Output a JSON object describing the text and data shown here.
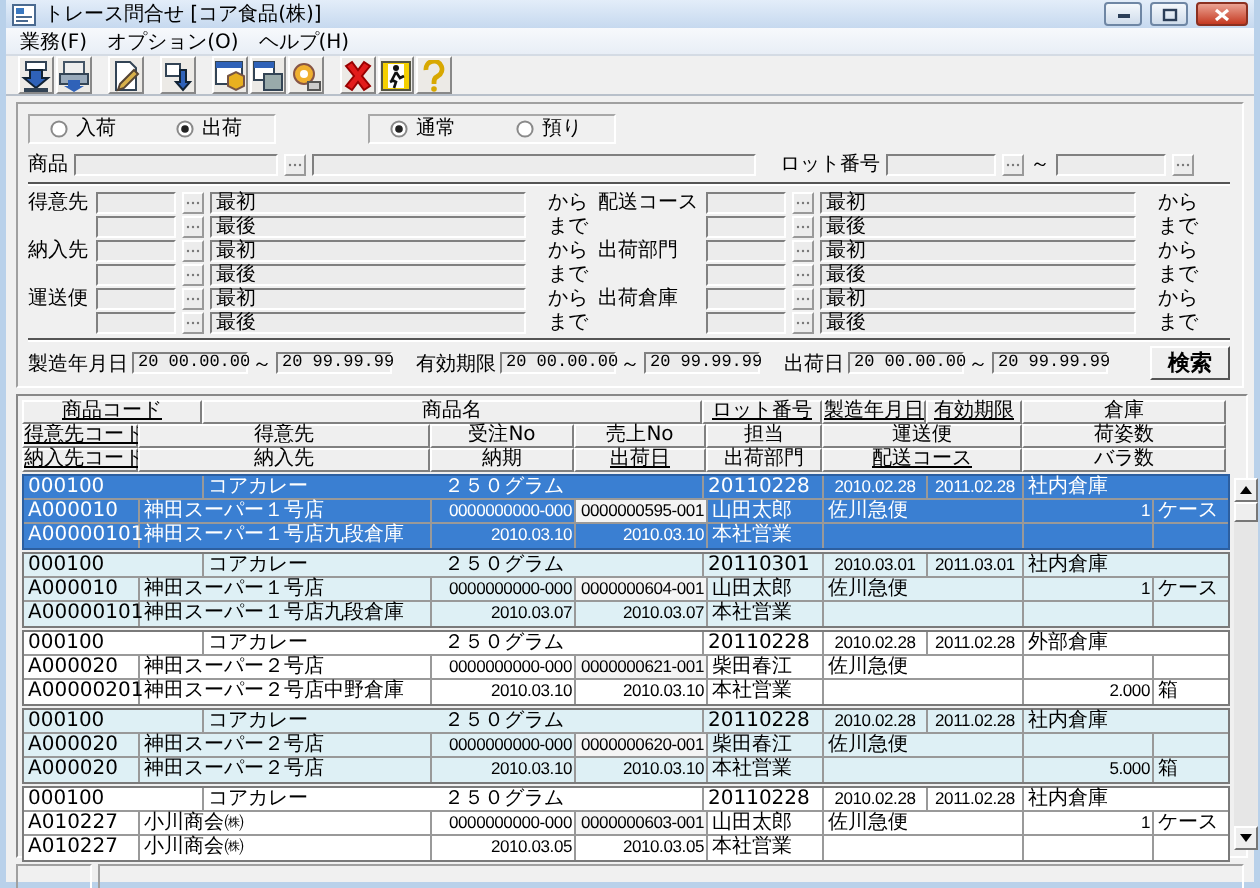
{
  "window": {
    "title": "トレース問合せ [コア食品(株)]"
  },
  "menu": [
    "業務(F)",
    "オプション(O)",
    "ヘルプ(H)"
  ],
  "filters": {
    "direction": [
      {
        "label": "入荷",
        "selected": false
      },
      {
        "label": "出荷",
        "selected": true
      }
    ],
    "mode": [
      {
        "label": "通常",
        "selected": true
      },
      {
        "label": "預り",
        "selected": false
      }
    ],
    "product": {
      "label": "商品"
    },
    "lot": {
      "label": "ロット番号",
      "separator": "～"
    },
    "ranges": [
      {
        "left": {
          "label": "得意先",
          "value": "最初",
          "suffix": "から"
        },
        "right": {
          "label": "配送コース",
          "value": "最初",
          "suffix": "から"
        }
      },
      {
        "left": {
          "value": "最後",
          "suffix": "まで"
        },
        "right": {
          "value": "最後",
          "suffix": "まで"
        }
      },
      {
        "left": {
          "label": "納入先",
          "value": "最初",
          "suffix": "から"
        },
        "right": {
          "label": "出荷部門",
          "value": "最初",
          "suffix": "から"
        }
      },
      {
        "left": {
          "value": "最後",
          "suffix": "まで"
        },
        "right": {
          "value": "最後",
          "suffix": "まで"
        }
      },
      {
        "left": {
          "label": "運送便",
          "value": "最初",
          "suffix": "から"
        },
        "right": {
          "label": "出荷倉庫",
          "value": "最初",
          "suffix": "から"
        }
      },
      {
        "left": {
          "value": "最後",
          "suffix": "まで"
        },
        "right": {
          "value": "最後",
          "suffix": "まで"
        }
      }
    ],
    "dates": [
      {
        "label": "製造年月日",
        "from": "20 00.00.00",
        "separator": "～",
        "to": "20 99.99.99"
      },
      {
        "label": "有効期限",
        "from": "20 00.00.00",
        "separator": "～",
        "to": "20 99.99.99"
      },
      {
        "label": "出荷日",
        "from": "20 00.00.00",
        "separator": "～",
        "to": "20 99.99.99"
      }
    ],
    "search_button": "検索"
  },
  "table": {
    "header_rows": [
      [
        {
          "label": "商品コード",
          "sortable": true
        },
        {
          "label": "商品名",
          "sortable": false
        },
        {
          "label": "ロット番号",
          "sortable": true
        },
        {
          "label": "製造年月日",
          "sortable": true
        },
        {
          "label": "有効期限",
          "sortable": true
        },
        {
          "label": "倉庫",
          "sortable": false
        }
      ],
      [
        {
          "label": "得意先コード",
          "sortable": true
        },
        {
          "label": "得意先",
          "sortable": false
        },
        {
          "label": "受注No",
          "sortable": false
        },
        {
          "label": "売上No",
          "sortable": false
        },
        {
          "label": "担当",
          "sortable": false
        },
        {
          "label": "運送便",
          "sortable": false
        },
        {
          "label": "荷姿数",
          "sortable": false
        }
      ],
      [
        {
          "label": "納入先コード",
          "sortable": true
        },
        {
          "label": "納入先",
          "sortable": false
        },
        {
          "label": "納期",
          "sortable": false
        },
        {
          "label": "出荷日",
          "sortable": true
        },
        {
          "label": "出荷部門",
          "sortable": false
        },
        {
          "label": "配送コース",
          "sortable": true
        },
        {
          "label": "バラ数",
          "sortable": false
        }
      ]
    ],
    "records": [
      {
        "selected": true,
        "product": {
          "code": "000100",
          "name": "コアカレー",
          "spec": "２５０グラム",
          "lot": "20110228",
          "manufactured": "2010.02.28",
          "expires": "2011.02.28",
          "warehouse": "社内倉庫"
        },
        "customer": {
          "code": "A000010",
          "name": "神田スーパー１号店",
          "order_no": "0000000000-000",
          "sales_no": "0000000595-001",
          "staff": "山田太郎",
          "carrier": "佐川急便",
          "quantity": "1",
          "unit": "ケース"
        },
        "delivery": {
          "code": "A00000101",
          "name": "神田スーパー１号店九段倉庫",
          "due": "2010.03.10",
          "shipped": "2010.03.10",
          "department": "本社営業"
        }
      },
      {
        "selected": false,
        "product": {
          "code": "000100",
          "name": "コアカレー",
          "spec": "２５０グラム",
          "lot": "20110301",
          "manufactured": "2010.03.01",
          "expires": "2011.03.01",
          "warehouse": "社内倉庫"
        },
        "customer": {
          "code": "A000010",
          "name": "神田スーパー１号店",
          "order_no": "0000000000-000",
          "sales_no": "0000000604-001",
          "staff": "山田太郎",
          "carrier": "佐川急便",
          "quantity": "1",
          "unit": "ケース"
        },
        "delivery": {
          "code": "A00000101",
          "name": "神田スーパー１号店九段倉庫",
          "due": "2010.03.07",
          "shipped": "2010.03.07",
          "department": "本社営業"
        }
      },
      {
        "selected": false,
        "product": {
          "code": "000100",
          "name": "コアカレー",
          "spec": "２５０グラム",
          "lot": "20110228",
          "manufactured": "2010.02.28",
          "expires": "2011.02.28",
          "warehouse": "外部倉庫"
        },
        "customer": {
          "code": "A000020",
          "name": "神田スーパー２号店",
          "order_no": "0000000000-000",
          "sales_no": "0000000621-001",
          "staff": "柴田春江",
          "carrier": "佐川急便"
        },
        "delivery": {
          "code": "A00000201",
          "name": "神田スーパー２号店中野倉庫",
          "due": "2010.03.10",
          "shipped": "2010.03.10",
          "department": "本社営業",
          "quantity": "2.000",
          "unit": "箱"
        }
      },
      {
        "selected": false,
        "product": {
          "code": "000100",
          "name": "コアカレー",
          "spec": "２５０グラム",
          "lot": "20110228",
          "manufactured": "2010.02.28",
          "expires": "2011.02.28",
          "warehouse": "社内倉庫"
        },
        "customer": {
          "code": "A000020",
          "name": "神田スーパー２号店",
          "order_no": "0000000000-000",
          "sales_no": "0000000620-001",
          "staff": "柴田春江",
          "carrier": "佐川急便"
        },
        "delivery": {
          "code": "A000020",
          "name": "神田スーパー２号店",
          "due": "2010.03.10",
          "shipped": "2010.03.10",
          "department": "本社営業",
          "quantity": "5.000",
          "unit": "箱"
        }
      },
      {
        "selected": false,
        "product": {
          "code": "000100",
          "name": "コアカレー",
          "spec": "２５０グラム",
          "lot": "20110228",
          "manufactured": "2010.02.28",
          "expires": "2011.02.28",
          "warehouse": "社内倉庫"
        },
        "customer": {
          "code": "A010227",
          "name": "小川商会㈱",
          "order_no": "0000000000-000",
          "sales_no": "0000000603-001",
          "staff": "山田太郎",
          "carrier": "佐川急便",
          "quantity": "1",
          "unit": "ケース"
        },
        "delivery": {
          "code": "A010227",
          "name": "小川商会㈱",
          "due": "2010.03.05",
          "shipped": "2010.03.05",
          "department": "本社営業"
        }
      }
    ]
  }
}
